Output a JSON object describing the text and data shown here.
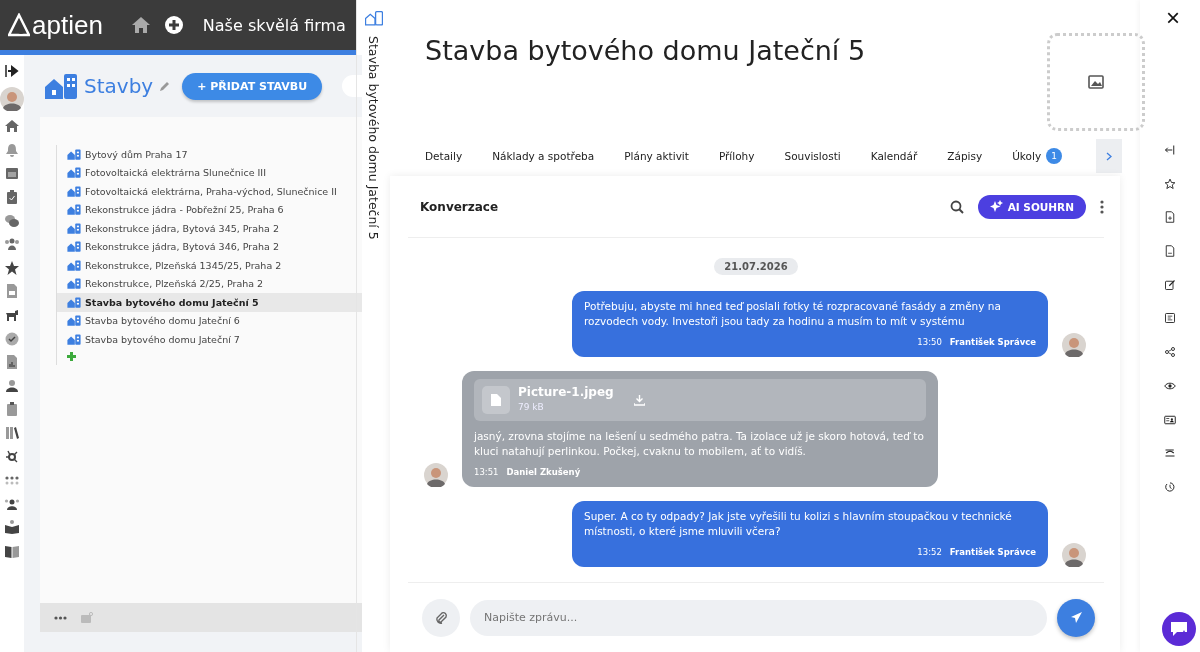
{
  "header": {
    "logo": "aptien",
    "company": "Naše skvělá firma"
  },
  "module": {
    "title": "Stavby",
    "add_button": "+ PŘIDAT STAVBU"
  },
  "tree": [
    {
      "label": "Bytový dům Praha 17",
      "selected": false
    },
    {
      "label": "Fotovoltaická elektrárna Slunečnice III",
      "selected": false
    },
    {
      "label": "Fotovoltaická elektrárna, Praha-východ, Slunečnice II",
      "selected": false
    },
    {
      "label": "Rekonstrukce jádra - Pobřežní 25, Praha 6",
      "selected": false
    },
    {
      "label": "Rekonstrukce jádra, Bytová 345, Praha 2",
      "selected": false
    },
    {
      "label": "Rekonstrukce jádra, Bytová 346, Praha 2",
      "selected": false
    },
    {
      "label": "Rekonstrukce, Plzeňská 1345/25, Praha 2",
      "selected": false
    },
    {
      "label": "Rekonstrukce, Plzeňská 2/25, Praha 2",
      "selected": false
    },
    {
      "label": "Stavba bytového domu Jateční 5",
      "selected": true
    },
    {
      "label": "Stavba bytového domu Jateční 6",
      "selected": false
    },
    {
      "label": "Stavba bytového domu Jateční 7",
      "selected": false
    }
  ],
  "detail": {
    "side_title": "Stavba bytového domu Jateční 5",
    "title": "Stavba bytového domu Jateční 5",
    "close": "×"
  },
  "tabs": [
    {
      "label": "Detaily"
    },
    {
      "label": "Náklady a spotřeba"
    },
    {
      "label": "Plány aktivit"
    },
    {
      "label": "Přílohy"
    },
    {
      "label": "Souvislosti"
    },
    {
      "label": "Kalendář"
    },
    {
      "label": "Zápisy"
    },
    {
      "label": "Úkoly",
      "badge": "1"
    }
  ],
  "chat": {
    "title": "Konverzace",
    "ai_button": "AI SOUHRN",
    "date": "21.07.2026",
    "placeholder": "Napište zprávu...",
    "messages": [
      {
        "kind": "outgoing",
        "text": "Potřebuju, abyste mi hned teď poslali fotky té rozpracované fasády a změny na rozvodech vody. Investoři jsou tady za hodinu a musím to mít v systému",
        "time": "13:50",
        "author": "František Správce"
      },
      {
        "kind": "incoming",
        "attachment": {
          "name": "Picture-1.jpeg",
          "size": "79 kB"
        },
        "text": "jasný, zrovna stojíme na lešení u sedmého patra. Ta izolace už je skoro hotová, teď to kluci natahují perlinkou. Počkej, cvaknu to mobilem, ať to vidíš.",
        "time": "13:51",
        "author": "Daniel Zkušený"
      },
      {
        "kind": "outgoing",
        "text": "Super. A co ty odpady? Jak jste vyřešili tu kolizi s hlavním stoupačkou v technické místnosti, o které jsme mluvili včera?",
        "time": "13:52",
        "author": "František Správce"
      }
    ]
  }
}
